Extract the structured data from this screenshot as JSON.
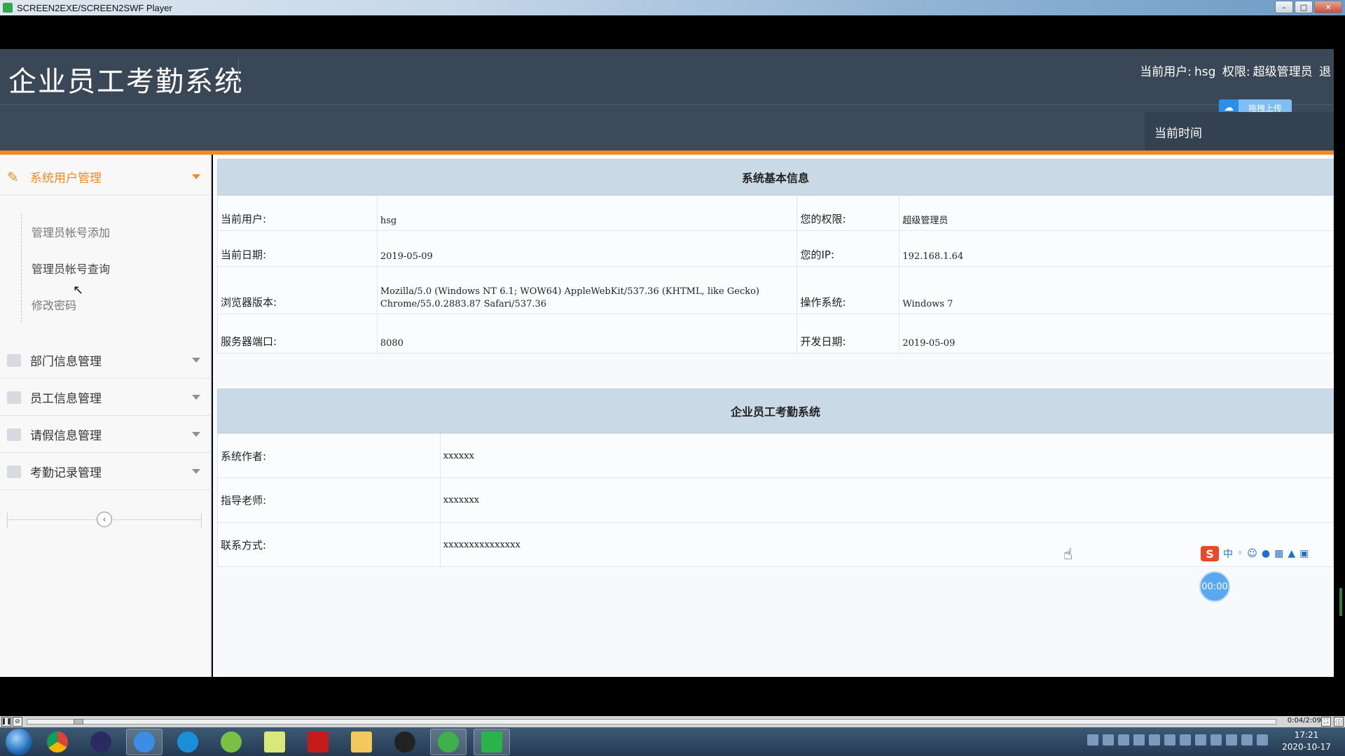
{
  "window": {
    "title": "SCREEN2EXE/SCREEN2SWF Player",
    "btn_min": "–",
    "btn_max": "□",
    "btn_close": "✕"
  },
  "header": {
    "brand": "企业员工考勤系统",
    "user_label": "当前用户:",
    "user_name": "hsg",
    "role_label": "权限:",
    "role_value": "超级管理员",
    "logout_partial": "退",
    "upload_label": "拖拽上传",
    "time_label": "当前时间"
  },
  "sidebar": {
    "groups": [
      {
        "label": "系统用户管理"
      },
      {
        "label": "部门信息管理"
      },
      {
        "label": "员工信息管理"
      },
      {
        "label": "请假信息管理"
      },
      {
        "label": "考勤记录管理"
      }
    ],
    "sub_items": [
      {
        "label": "管理员帐号添加"
      },
      {
        "label": "管理员帐号查询"
      },
      {
        "label": "修改密码"
      }
    ],
    "collapse_glyph": "‹"
  },
  "panel1": {
    "title": "系统基本信息",
    "rows": [
      {
        "l1": "当前用户:",
        "v1": "hsg",
        "l2": "您的权限:",
        "v2": "超级管理员"
      },
      {
        "l1": "当前日期:",
        "v1": "2019-05-09",
        "l2": "您的IP:",
        "v2": "192.168.1.64"
      },
      {
        "l1": "浏览器版本:",
        "v1a": "Mozilla/5.0 (Windows NT 6.1; WOW64) AppleWebKit/537.36 (KHTML, like Gecko)",
        "v1b": "Chrome/55.0.2883.87 Safari/537.36",
        "l2": "操作系统:",
        "v2": "Windows 7"
      },
      {
        "l1": "服务器端口:",
        "v1": "8080",
        "l2": "开发日期:",
        "v2": "2019-05-09"
      }
    ]
  },
  "panel2": {
    "title": "企业员工考勤系统",
    "rows": [
      {
        "label": "系统作者:",
        "value": "xxxxxx"
      },
      {
        "label": "指导老师:",
        "value": "xxxxxxx"
      },
      {
        "label": "联系方式:",
        "value": "xxxxxxxxxxxxxxx"
      }
    ]
  },
  "overlay": {
    "timer": "00:00",
    "ime_s": "S",
    "ime_mode": "中"
  },
  "player": {
    "time": "0:04/2:09"
  },
  "taskbar": {
    "clock_time": "17:21",
    "clock_date": "2020-10-17"
  }
}
